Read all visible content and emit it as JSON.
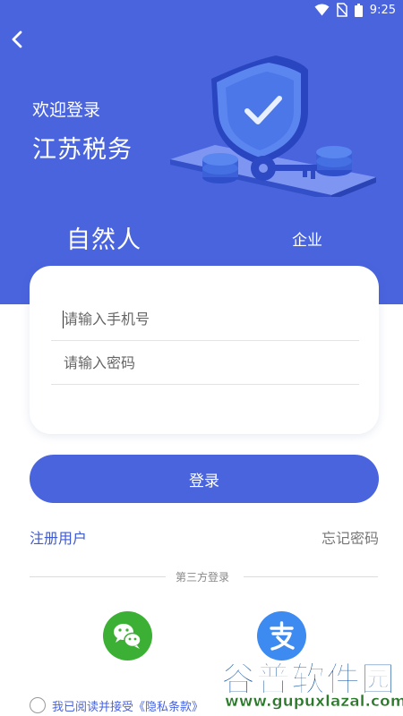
{
  "status_bar": {
    "time": "9:25",
    "icons": [
      "wifi-icon",
      "no-sim-icon",
      "battery-icon"
    ]
  },
  "header": {
    "back_icon": "chevron-left-icon",
    "welcome": "欢迎登录",
    "bureau": "江苏税务",
    "illustration_icon": "shield-check-icon"
  },
  "tabs": [
    {
      "label": "自然人",
      "selected": true
    },
    {
      "label": "企业",
      "selected": false
    }
  ],
  "form": {
    "phone_placeholder": "请输入手机号",
    "password_placeholder": "请输入密码"
  },
  "login_button": "登录",
  "links": {
    "register": "注册用户",
    "forgot": "忘记密码"
  },
  "third_party": {
    "label": "第三方登录",
    "providers": [
      {
        "name": "wechat",
        "icon": "wechat-icon",
        "color": "#3CB034"
      },
      {
        "name": "alipay",
        "icon": "alipay-icon",
        "color": "#3D8BF0"
      }
    ]
  },
  "agreement": {
    "checked": false,
    "text": "我已阅读并接受《隐私条款》"
  },
  "watermark": {
    "brand": "谷普软件园",
    "url": "www.gupuxlazal.com"
  },
  "colors": {
    "primary": "#4A64DE",
    "link": "#3D5AD6",
    "wechat": "#3CB034",
    "alipay": "#3D8BF0"
  }
}
